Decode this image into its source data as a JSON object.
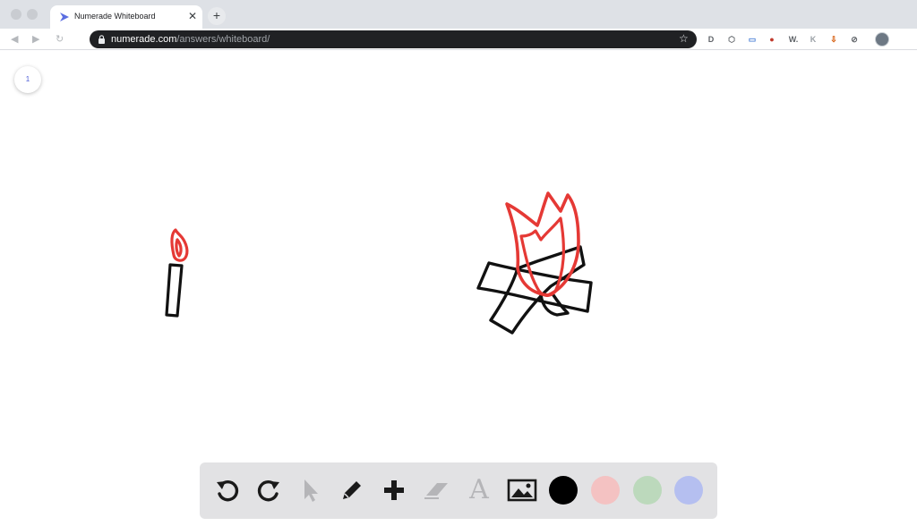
{
  "browser": {
    "tab": {
      "title": "Numerade Whiteboard",
      "close_glyph": "✕",
      "favicon": "numerade-logo-icon"
    },
    "new_tab_glyph": "+",
    "omnibox": {
      "domain": "numerade.com",
      "path": "/answers/whiteboard/",
      "star_glyph": "☆"
    },
    "extensions": [
      {
        "name": "extension-d-icon",
        "glyph": "D"
      },
      {
        "name": "extension-hex-icon",
        "glyph": "⬡"
      },
      {
        "name": "extension-doc-icon",
        "glyph": "▭"
      },
      {
        "name": "extension-dots-icon",
        "glyph": "●"
      },
      {
        "name": "extension-w-icon",
        "glyph": "W."
      },
      {
        "name": "extension-k-icon",
        "glyph": "K"
      },
      {
        "name": "extension-download-icon",
        "glyph": "⇩"
      },
      {
        "name": "extension-compass-icon",
        "glyph": "⊘"
      }
    ]
  },
  "whiteboard": {
    "page_number": "1",
    "ink": {
      "red": "#e53935",
      "black": "#111111"
    },
    "toolbar": {
      "tools": [
        "undo-icon",
        "redo-icon",
        "pointer-icon",
        "pen-icon",
        "add-icon",
        "eraser-icon",
        "text-icon",
        "image-icon"
      ],
      "text_tool_glyph": "A",
      "colors": [
        {
          "name": "black",
          "hex": "#000000",
          "selected": true
        },
        {
          "name": "pink",
          "hex": "#f4c2c2",
          "selected": false
        },
        {
          "name": "green",
          "hex": "#bcd9bc",
          "selected": false
        },
        {
          "name": "blue",
          "hex": "#b5bff0",
          "selected": false
        }
      ]
    }
  }
}
